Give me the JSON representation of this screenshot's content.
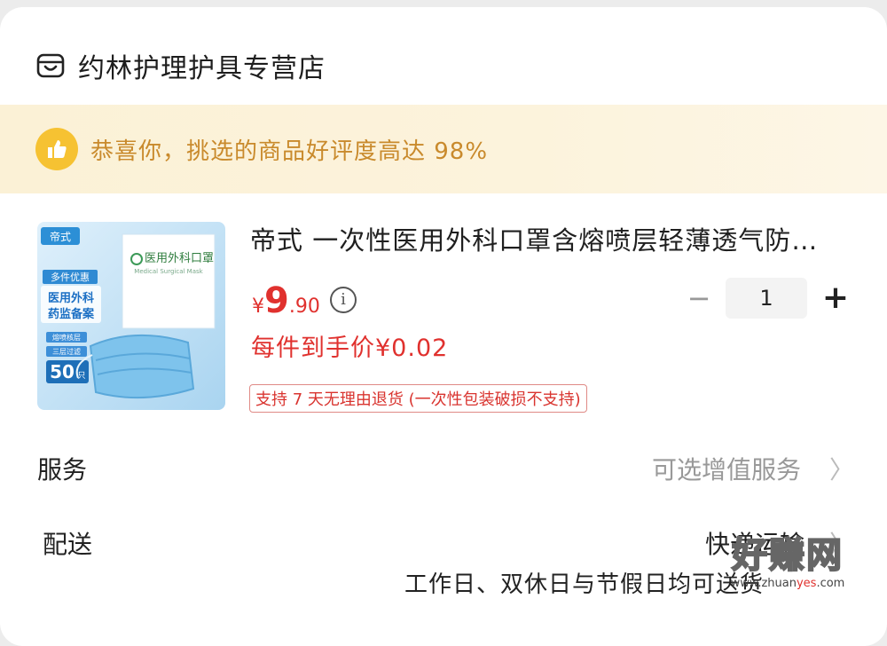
{
  "store": {
    "name": "约林护理护具专营店",
    "icon": "store-icon"
  },
  "banner": {
    "text": "恭喜你，挑选的商品好评度高达 98%",
    "icon": "thumbs-up-icon",
    "accent": "#f6c232"
  },
  "product": {
    "image_texts": {
      "brand": "帝式",
      "promo": "多件优惠",
      "cert_line1": "医用外科",
      "cert_line2": "药监备案",
      "pack_title": "医用外科口罩",
      "pack_subtitle": "Medical Surgical Mask",
      "feature1": "熔喷核层",
      "feature2": "三层过滤",
      "count": "50",
      "count_unit": "只"
    },
    "title": "帝式 一次性医用外科口罩含熔喷层轻薄透气防…",
    "price": {
      "currency": "¥",
      "integer": "9",
      "decimal": ".90"
    },
    "quantity": "1",
    "minus_label": "−",
    "plus_label": "+",
    "final_price": "每件到手价¥0.02",
    "return_policy": "支持 7 天无理由退货 (一次性包装破损不支持)",
    "price_color": "#e0312e"
  },
  "service": {
    "label": "服务",
    "value": "可选增值服务",
    "chevron": "〉"
  },
  "delivery": {
    "label": "配送",
    "value": "快递运输",
    "chevron": "〉",
    "note": "工作日、双休日与节假日均可送货"
  },
  "watermark": {
    "main": "好赚网",
    "sub_prefix": "www.zhuan",
    "sub_accent": "yes",
    "sub_suffix": ".com"
  }
}
